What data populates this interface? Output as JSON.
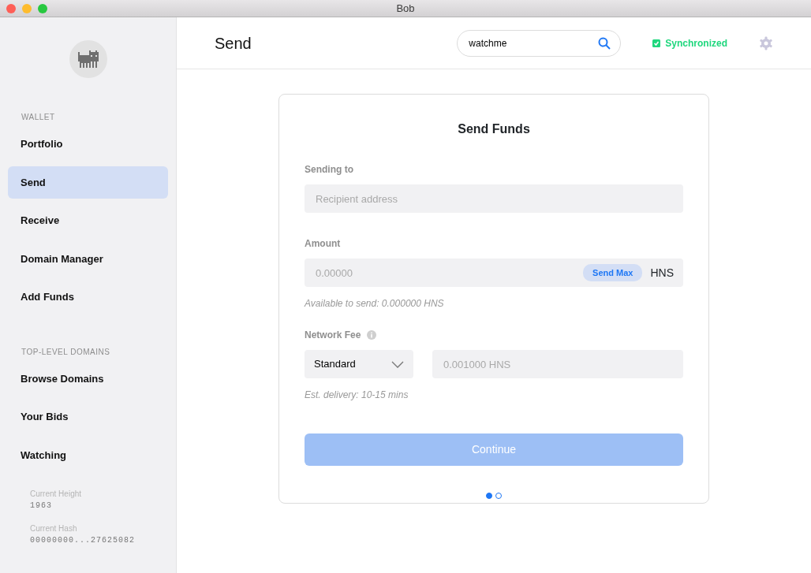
{
  "window": {
    "title": "Bob"
  },
  "sidebar": {
    "sections": [
      {
        "heading": "WALLET",
        "items": [
          {
            "label": "Portfolio",
            "selected": false
          },
          {
            "label": "Send",
            "selected": true
          },
          {
            "label": "Receive",
            "selected": false
          },
          {
            "label": "Domain Manager",
            "selected": false
          },
          {
            "label": "Add Funds",
            "selected": false
          }
        ]
      },
      {
        "heading": "TOP-LEVEL DOMAINS",
        "items": [
          {
            "label": "Browse Domains",
            "selected": false
          },
          {
            "label": "Your Bids",
            "selected": false
          },
          {
            "label": "Watching",
            "selected": false
          }
        ]
      }
    ],
    "info": [
      {
        "label": "Current Height",
        "value": "1963"
      },
      {
        "label": "Current Hash",
        "value": "00000000...27625082"
      }
    ]
  },
  "header": {
    "title": "Send",
    "search": {
      "value": "watchme"
    },
    "sync_status": {
      "label": "Synchronized",
      "synced": true
    }
  },
  "form": {
    "title": "Send Funds",
    "recipient": {
      "label": "Sending to",
      "placeholder": "Recipient address"
    },
    "amount": {
      "label": "Amount",
      "placeholder": "0.00000",
      "max_button": "Send Max",
      "unit": "HNS",
      "hint": "Available to send: 0.000000 HNS"
    },
    "fee": {
      "label": "Network Fee",
      "option": "Standard",
      "placeholder": "0.001000 HNS",
      "hint": "Est. delivery: 10-15 mins"
    },
    "continue": {
      "label": "Continue",
      "disabled": true
    },
    "steps": [
      {
        "selected": true
      },
      {
        "selected": false
      }
    ]
  }
}
